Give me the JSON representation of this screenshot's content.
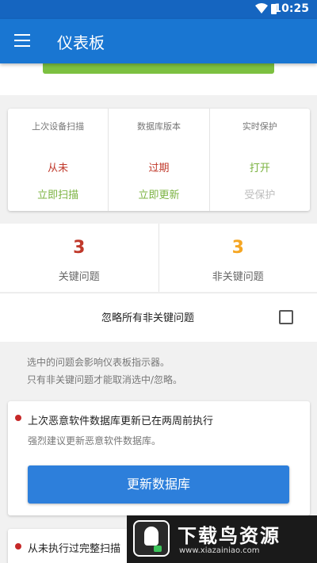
{
  "status_bar": {
    "time": "10:25"
  },
  "app_bar": {
    "title": "仪表板"
  },
  "status_card": [
    {
      "heading": "上次设备扫描",
      "value": "从未",
      "value_color": "#c0392b",
      "action": "立即扫描",
      "action_color": "#7cb342"
    },
    {
      "heading": "数据库版本",
      "value": "过期",
      "value_color": "#c0392b",
      "action": "立即更新",
      "action_color": "#7cb342"
    },
    {
      "heading": "实时保护",
      "value": "打开",
      "value_color": "#7cb342",
      "action": "受保护",
      "action_color": "#bdbdbd"
    }
  ],
  "counts": [
    {
      "number": "3",
      "color": "#c0392b",
      "label": "关键问题"
    },
    {
      "number": "3",
      "color": "#f5a623",
      "label": "非关键问题"
    }
  ],
  "ignore": {
    "label": "忽略所有非关键问题",
    "checked": false
  },
  "notes": {
    "line1": "选中的问题会影响仪表板指示器。",
    "line2": "只有非关键问题才能取消选中/忽略。"
  },
  "issues": [
    {
      "title": "上次恶意软件数据库更新已在两周前执行",
      "desc": "强烈建议更新恶意软件数据库。",
      "button": "更新数据库"
    },
    {
      "title": "从未执行过完整扫描"
    }
  ],
  "watermark": {
    "brand": "下载鸟资源",
    "url": "www.xiazainiao.com"
  }
}
